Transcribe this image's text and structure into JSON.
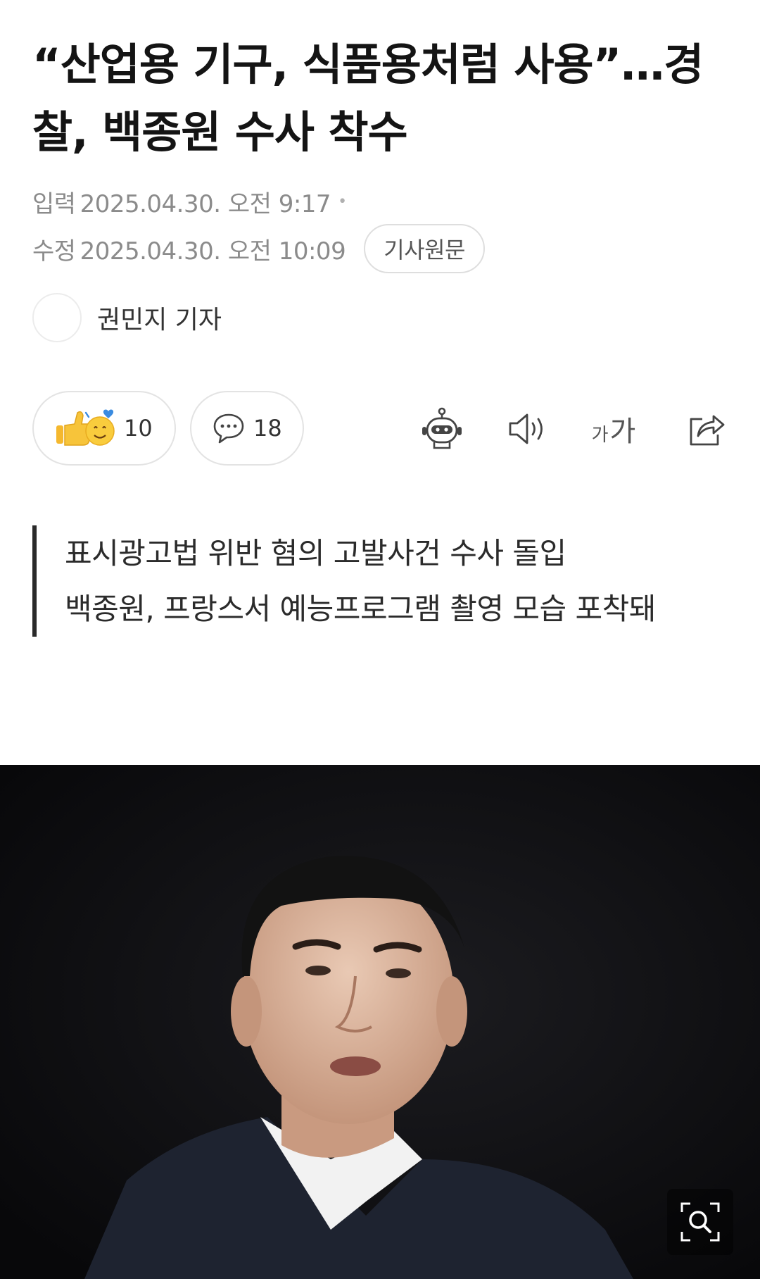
{
  "article": {
    "title": "“산업용 기구, 식품용처럼 사용”…경찰, 백종원 수사 착수",
    "published_label": "입력",
    "published": "2025.04.30. 오전 9:17",
    "updated_label": "수정",
    "updated": "2025.04.30. 오전 10:09",
    "source_button": "기사원문",
    "reporter": "권민지 기자"
  },
  "actions": {
    "reaction_count": "10",
    "comment_count": "18",
    "icons": [
      "thumbs-up-emoji",
      "heart-eyes-emoji",
      "comment-bubble-icon",
      "robot-summary-icon",
      "speaker-icon",
      "font-size-icon",
      "share-icon"
    ],
    "font_size_small": "가",
    "font_size_large": "가"
  },
  "summary": [
    "표시광고법 위반 혐의 고발사건 수사 돌입",
    "백종원, 프랑스서 예능프로그램 촬영 모습 포착돼"
  ],
  "photo": {
    "zoom_icon": "zoom-magnifier-icon"
  },
  "colors": {
    "title": "#141414",
    "meta": "#8b8b8b",
    "summary_bar": "#2a2a2a",
    "photo_bg": "#0d0d0f"
  }
}
